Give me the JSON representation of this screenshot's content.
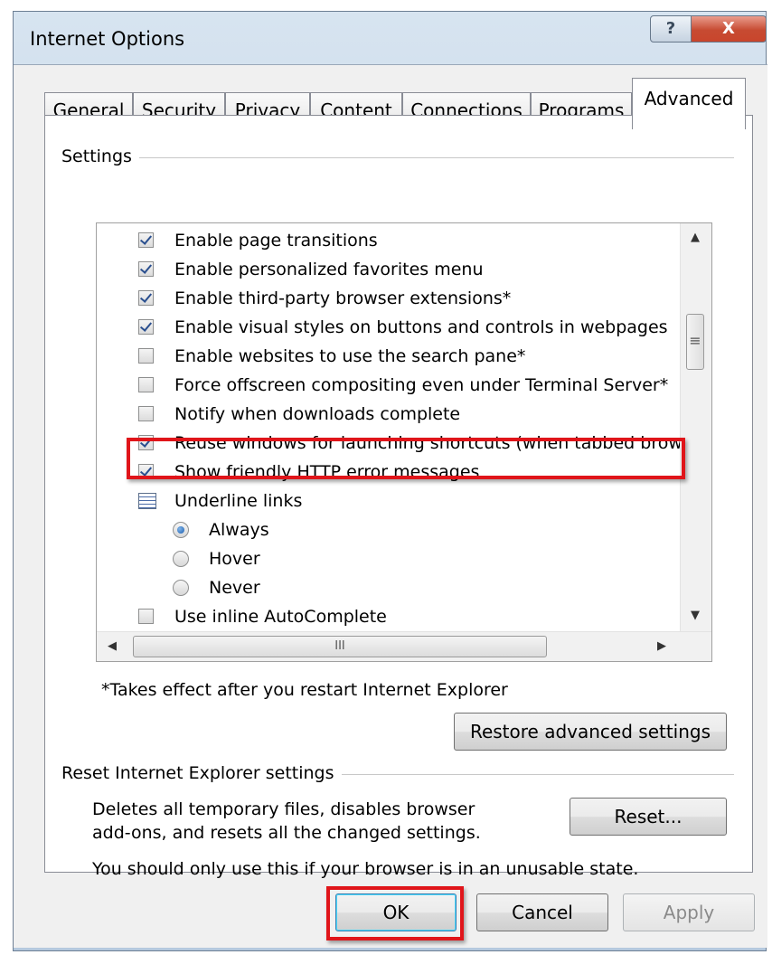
{
  "window": {
    "title": "Internet Options",
    "help_glyph": "?",
    "close_glyph": "X"
  },
  "tabs": [
    "General",
    "Security",
    "Privacy",
    "Content",
    "Connections",
    "Programs",
    "Advanced"
  ],
  "active_tab": "Advanced",
  "settings": {
    "group_label": "Settings",
    "items": [
      {
        "type": "checkbox",
        "checked": true,
        "label": "Enable page transitions"
      },
      {
        "type": "checkbox",
        "checked": true,
        "label": "Enable personalized favorites menu"
      },
      {
        "type": "checkbox",
        "checked": true,
        "label": "Enable third-party browser extensions*"
      },
      {
        "type": "checkbox",
        "checked": true,
        "label": "Enable visual styles on buttons and controls in webpages"
      },
      {
        "type": "checkbox",
        "checked": false,
        "label": "Enable websites to use the search pane*"
      },
      {
        "type": "checkbox",
        "checked": false,
        "label": "Force offscreen compositing even under Terminal Server*"
      },
      {
        "type": "checkbox",
        "checked": false,
        "label": "Notify when downloads complete"
      },
      {
        "type": "checkbox",
        "checked": true,
        "label": "Reuse windows for launching shortcuts (when tabbed brow"
      },
      {
        "type": "checkbox",
        "checked": true,
        "label": "Show friendly HTTP error messages"
      },
      {
        "type": "group",
        "label": "Underline links"
      },
      {
        "type": "radio",
        "checked": true,
        "label": "Always"
      },
      {
        "type": "radio",
        "checked": false,
        "label": "Hover"
      },
      {
        "type": "radio",
        "checked": false,
        "label": "Never"
      },
      {
        "type": "checkbox",
        "checked": false,
        "label": "Use inline AutoComplete"
      }
    ],
    "hscroll_thumb_glyph": "III",
    "vscroll_thumb_glyph": "≡",
    "restart_note": "*Takes effect after you restart Internet Explorer",
    "restore_button": "Restore advanced settings"
  },
  "reset_section": {
    "group_label": "Reset Internet Explorer settings",
    "description_line1": "Deletes all temporary files, disables browser",
    "description_line2": "add-ons, and resets all the changed settings.",
    "warning": "You should only use this if your browser is in an unusable state.",
    "reset_button": "Reset..."
  },
  "footer": {
    "ok": "OK",
    "cancel": "Cancel",
    "apply": "Apply"
  },
  "colors": {
    "highlight": "#e0151a"
  }
}
